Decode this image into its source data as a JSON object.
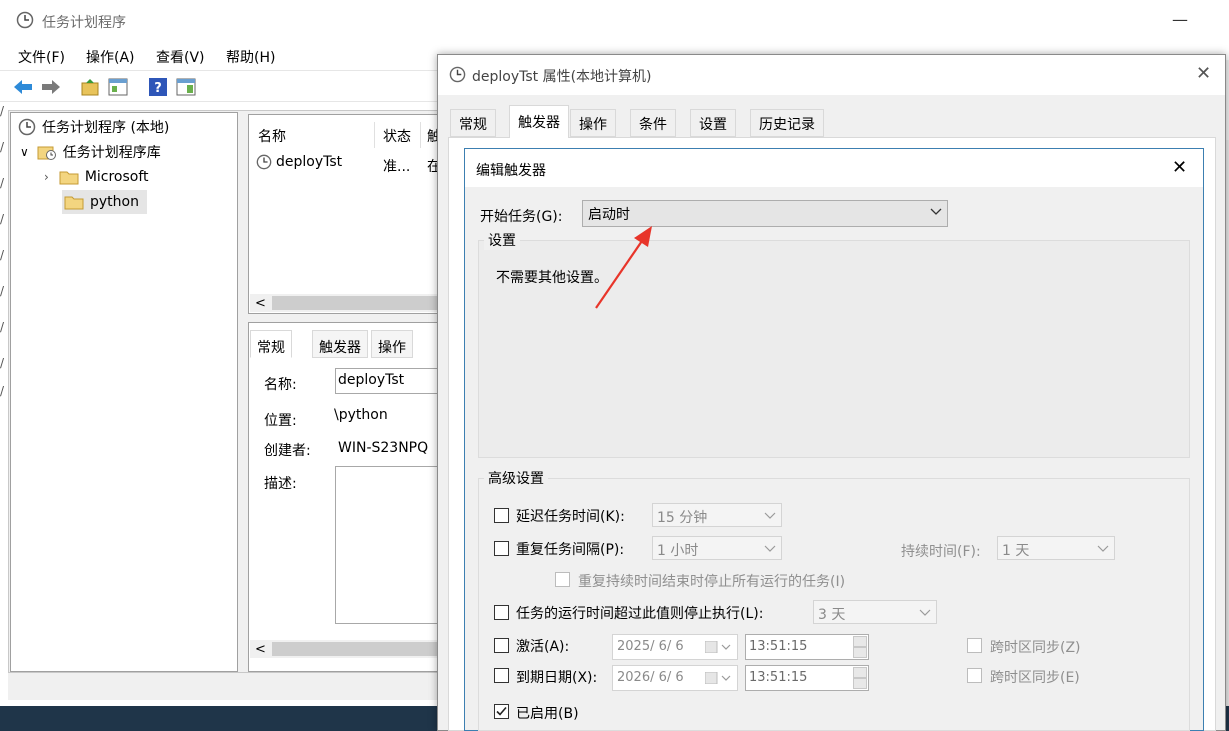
{
  "main": {
    "title": "任务计划程序",
    "menu": [
      "文件(F)",
      "操作(A)",
      "查看(V)",
      "帮助(H)"
    ],
    "tree": {
      "root": "任务计划程序 (本地)",
      "library": "任务计划程序库",
      "microsoft": "Microsoft",
      "python": "python"
    },
    "list": {
      "headers": [
        "名称",
        "状态",
        "触"
      ],
      "row": {
        "name": "deployTst",
        "status": "准...",
        "trigger": "在"
      }
    },
    "detail": {
      "tabs": [
        "常规",
        "触发器",
        "操作"
      ],
      "name_label": "名称:",
      "name_value": "deployTst",
      "location_label": "位置:",
      "location_value": "\\python",
      "author_label": "创建者:",
      "author_value": "WIN-S23NPQ",
      "desc_label": "描述:"
    }
  },
  "properties": {
    "title": "deployTst 属性(本地计算机)",
    "tabs": [
      "常规",
      "触发器",
      "操作",
      "条件",
      "设置",
      "历史记录"
    ],
    "active_tab": "触发器"
  },
  "edit_trigger": {
    "title": "编辑触发器",
    "start_label": "开始任务(G):",
    "start_value": "启动时",
    "settings_legend": "设置",
    "settings_text": "不需要其他设置。",
    "advanced_legend": "高级设置",
    "delay": {
      "label": "延迟任务时间(K):",
      "value": "15 分钟",
      "checked": false
    },
    "repeat": {
      "label": "重复任务间隔(P):",
      "value": "1 小时",
      "checked": false
    },
    "duration": {
      "label": "持续时间(F):",
      "value": "1 天"
    },
    "stop_all": {
      "label": "重复持续时间结束时停止所有运行的任务(I)",
      "checked": false
    },
    "stop_if_longer": {
      "label": "任务的运行时间超过此值则停止执行(L):",
      "value": "3 天",
      "checked": false
    },
    "activate": {
      "label": "激活(A):",
      "date": "2025/  6/  6",
      "time": "13:51:15",
      "checked": false,
      "sync_label": "跨时区同步(Z)"
    },
    "expire": {
      "label": "到期日期(X):",
      "date": "2026/  6/  6",
      "time": "13:51:15",
      "checked": false,
      "sync_label": "跨时区同步(E)"
    },
    "enabled": {
      "label": "已启用(B)",
      "checked": true
    }
  },
  "colors": {
    "arrow": "#e8352a",
    "dialog_border": "#3c7fb1",
    "taskbar": "#1f3549"
  }
}
